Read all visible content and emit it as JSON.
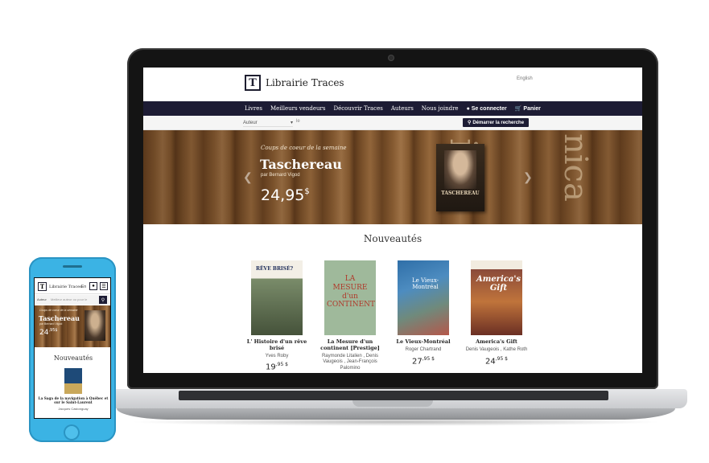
{
  "desktop": {
    "logo_letter": "T",
    "logo_text": "Librairie Traces",
    "language_link": "English",
    "nav": [
      {
        "label": "Livres"
      },
      {
        "label": "Meilleurs vendeurs"
      },
      {
        "label": "Découvrir Traces"
      },
      {
        "label": "Auteurs"
      },
      {
        "label": "Nous joindre"
      },
      {
        "label": "Se connecter",
        "icon": "user-icon"
      },
      {
        "label": "Panier",
        "icon": "cart-icon"
      }
    ],
    "search": {
      "field_select": "Auteur",
      "input_value": "le",
      "button_label": "Démarrer la recherche",
      "button_icon": "search-icon"
    },
    "hero": {
      "kicker": "Coups de coeur de la semaine",
      "title": "Taschereau",
      "author": "par Bernard Vigod",
      "price_main": "24,95",
      "price_currency": "$",
      "book_cover_title": "TASCHEREAU",
      "background_text_1": "ica",
      "background_text_2": "nica"
    },
    "section_title": "Nouveautés",
    "books": [
      {
        "title": "L' Histoire d'un rêve brisé",
        "author": "Yves Roby",
        "price_units": "19",
        "price_cents": ",95 $",
        "cover_text": "RÊVE BRISÉ?"
      },
      {
        "title": "La Mesure d'un continent [Prestige]",
        "author": "Raymonde Litalien , Denis Vaugeois , Jean-François Palomino",
        "price_units": "",
        "price_cents": "",
        "cover_text": "LA MESURE d'un CONTINENT"
      },
      {
        "title": "Le Vieux-Montréal",
        "author": "Roger Chartrand",
        "price_units": "27",
        "price_cents": ",95 $",
        "cover_text": "Le Vieux-Montréal"
      },
      {
        "title": "America's Gift",
        "author": "Denis Vaugeois , Kathe Roth",
        "price_units": "24",
        "price_cents": ",95 $",
        "cover_text": "America's Gift"
      }
    ]
  },
  "mobile": {
    "logo_letter": "T",
    "logo_text": "Librairie Traces",
    "language_link": "En",
    "search_select": "Auteur",
    "search_placeholder": "Meilleur auteur ou pour le",
    "hero_kicker": "Coups de coeur de la semaine",
    "hero_title": "Taschereau",
    "hero_author": "par Bernard Vigod",
    "hero_price_main": "24",
    "hero_price_cents": ",95$",
    "section_title": "Nouveautés",
    "book_title": "La Saga de la navigation à Québec et sur le Saint-Laurent",
    "book_author": "Jacques Castonguay"
  },
  "colors": {
    "nav_background": "#1d1c34",
    "phone_body": "#3bb3e4",
    "laptop_bezel": "#141414"
  }
}
